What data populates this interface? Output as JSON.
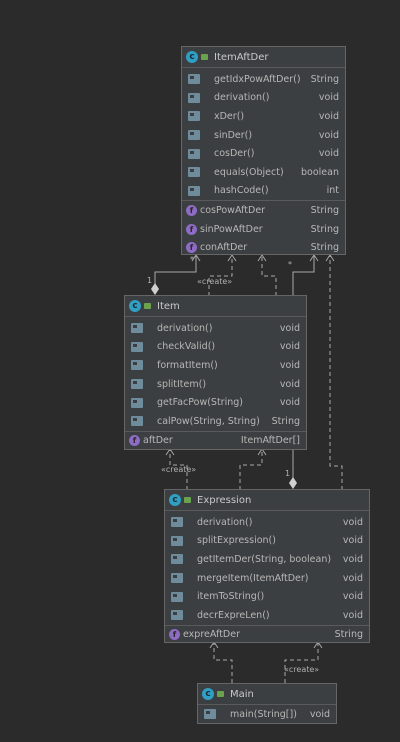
{
  "classes": {
    "itemAftDer": {
      "name": "ItemAftDer",
      "methods": [
        {
          "name": "getIdxPowAftDer()",
          "type": "String"
        },
        {
          "name": "derivation()",
          "type": "void"
        },
        {
          "name": "xDer()",
          "type": "void"
        },
        {
          "name": "sinDer()",
          "type": "void"
        },
        {
          "name": "cosDer()",
          "type": "void"
        },
        {
          "name": "equals(Object)",
          "type": "boolean"
        },
        {
          "name": "hashCode()",
          "type": "int"
        }
      ],
      "fields": [
        {
          "name": "cosPowAftDer",
          "type": "String"
        },
        {
          "name": "sinPowAftDer",
          "type": "String"
        },
        {
          "name": "conAftDer",
          "type": "String"
        }
      ]
    },
    "item": {
      "name": "Item",
      "methods": [
        {
          "name": "derivation()",
          "type": "void"
        },
        {
          "name": "checkValid()",
          "type": "void"
        },
        {
          "name": "formatItem()",
          "type": "void"
        },
        {
          "name": "splitItem()",
          "type": "void"
        },
        {
          "name": "getFacPow(String)",
          "type": "void"
        },
        {
          "name": "calPow(String, String)",
          "type": "String"
        }
      ],
      "fields": [
        {
          "name": "aftDer",
          "type": "ItemAftDer[]"
        }
      ]
    },
    "expression": {
      "name": "Expression",
      "methods": [
        {
          "name": "derivation()",
          "type": "void"
        },
        {
          "name": "splitExpression()",
          "type": "void"
        },
        {
          "name": "getItemDer(String, boolean)",
          "type": "void"
        },
        {
          "name": "mergeItem(ItemAftDer)",
          "type": "void"
        },
        {
          "name": "itemToString()",
          "type": "void"
        },
        {
          "name": "decrExpreLen()",
          "type": "void"
        }
      ],
      "fields": [
        {
          "name": "expreAftDer",
          "type": "String"
        }
      ]
    },
    "main": {
      "name": "Main",
      "methods": [
        {
          "name": "main(String[])",
          "type": "void"
        }
      ],
      "fields": []
    }
  },
  "labels": {
    "create1": "«create»",
    "create2": "«create»",
    "create3": "«create»",
    "mult_item_one": "1",
    "mult_item_star": "*",
    "mult_expr_one": "1",
    "mult_expr_star": "*"
  },
  "icons": {
    "class_icon_letter": "c",
    "field_icon_letter": "f"
  }
}
